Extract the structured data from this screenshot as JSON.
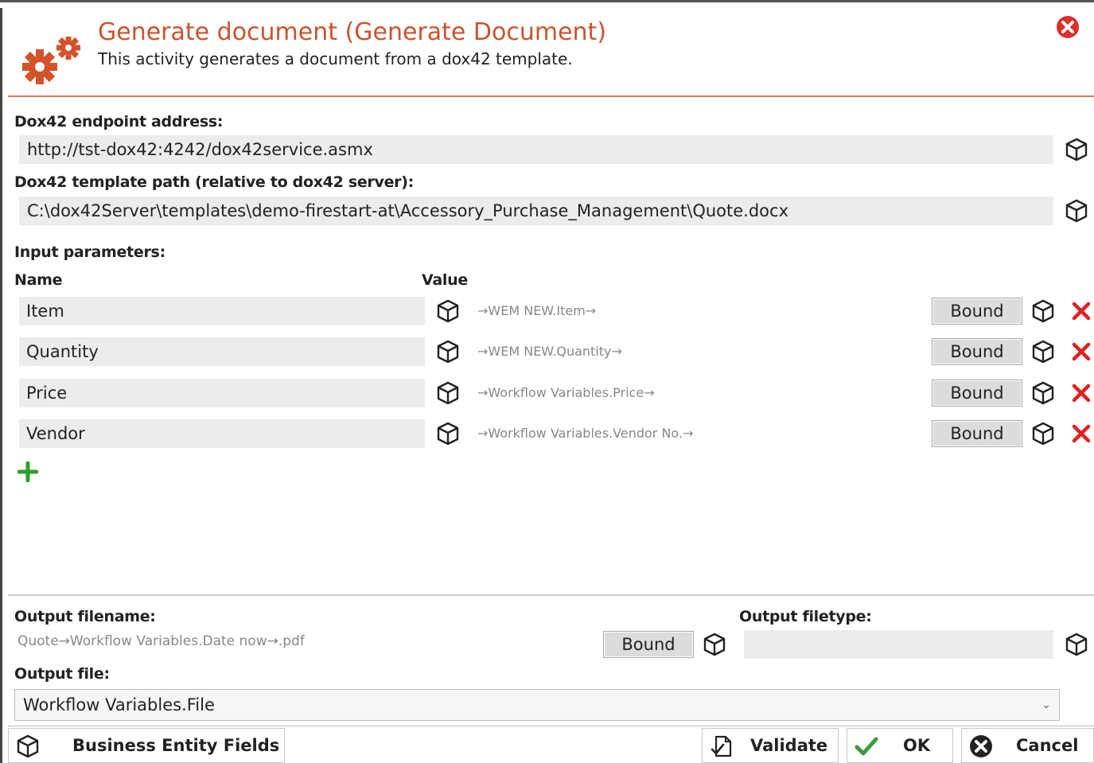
{
  "header": {
    "title": "Generate document (Generate Document)",
    "subtitle": "This activity generates a document from a dox42 template."
  },
  "endpoint": {
    "label": "Dox42 endpoint address:",
    "value": "http://tst-dox42:4242/dox42service.asmx"
  },
  "template_path": {
    "label": "Dox42 template path (relative to dox42 server):",
    "value": "C:\\dox42Server\\templates\\demo-firestart-at\\Accessory_Purchase_Management\\Quote.docx"
  },
  "input_params": {
    "label": "Input parameters:",
    "col_name": "Name",
    "col_value": "Value",
    "rows": [
      {
        "name": "Item",
        "value": "→WEM NEW.Item→",
        "button": "Bound"
      },
      {
        "name": "Quantity",
        "value": "→WEM NEW.Quantity→",
        "button": "Bound"
      },
      {
        "name": "Price",
        "value": "→Workflow Variables.Price→",
        "button": "Bound"
      },
      {
        "name": "Vendor",
        "value": "→Workflow Variables.Vendor No.→",
        "button": "Bound"
      }
    ]
  },
  "output": {
    "filename_label": "Output filename:",
    "filename_value": "Quote→Workflow Variables.Date now→.pdf",
    "filename_button": "Bound",
    "filetype_label": "Output filetype:",
    "filetype_value": "",
    "file_label": "Output file:",
    "file_value": "Workflow Variables.File"
  },
  "footer": {
    "business_entity": "Business Entity Fields",
    "validate": "Validate",
    "ok": "OK",
    "cancel": "Cancel"
  },
  "colors": {
    "accent": "#c8542f",
    "delete": "#e02020",
    "add": "#2e9e2e",
    "check": "#3a9d3a"
  }
}
